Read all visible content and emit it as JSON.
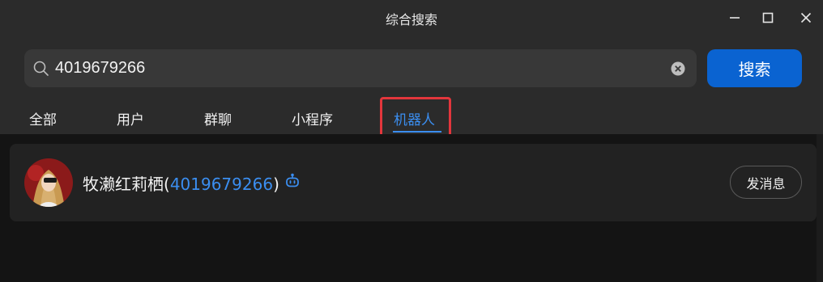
{
  "window": {
    "title": "综合搜索"
  },
  "search": {
    "value": "4019679266",
    "placeholder": "",
    "button_label": "搜索"
  },
  "tabs": [
    {
      "label": "全部",
      "active": false
    },
    {
      "label": "用户",
      "active": false
    },
    {
      "label": "群聊",
      "active": false
    },
    {
      "label": "小程序",
      "active": false
    },
    {
      "label": "机器人",
      "active": true
    }
  ],
  "results": [
    {
      "name": "牧濑红莉栖",
      "id_open": "(",
      "qq": "4019679266",
      "id_close": ")",
      "badge_icon": "robot-icon",
      "action_label": "发消息"
    }
  ],
  "colors": {
    "accent": "#3b8ef0",
    "primary_button": "#0a63d1",
    "highlight": "#e3363c"
  }
}
